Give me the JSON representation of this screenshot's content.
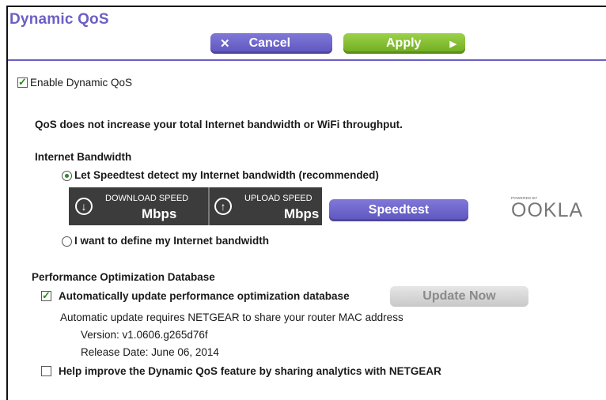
{
  "page": {
    "title": "Dynamic QoS"
  },
  "toolbar": {
    "cancel_label": "Cancel",
    "apply_label": "Apply"
  },
  "qos": {
    "enable_label": "Enable Dynamic QoS",
    "enabled": true,
    "note": "QoS does not increase your total Internet bandwidth or WiFi throughput."
  },
  "bandwidth": {
    "heading": "Internet Bandwidth",
    "option_speedtest": "Let Speedtest detect my Internet bandwidth (recommended)",
    "option_manual": "I want to define my Internet bandwidth",
    "selected": "speedtest",
    "download_label": "DOWNLOAD SPEED",
    "download_unit": "Mbps",
    "upload_label": "UPLOAD SPEED",
    "upload_unit": "Mbps",
    "speedtest_button": "Speedtest",
    "logo_tagline": "POWERED BY",
    "logo_text": "OOKLA"
  },
  "database": {
    "heading": "Performance Optimization Database",
    "auto_update_label": "Automatically update performance optimization database",
    "auto_update_checked": true,
    "update_button": "Update Now",
    "note": "Automatic update requires NETGEAR to share your router MAC address",
    "version": "Version: v1.0606.g265d76f",
    "release_date": "Release Date: June 06, 2014"
  },
  "analytics": {
    "label": "Help improve the Dynamic QoS feature by sharing analytics with NETGEAR",
    "checked": false
  },
  "colors": {
    "accent": "#6a5fc4",
    "apply": "#7ab82a",
    "check": "#2a8a20"
  }
}
